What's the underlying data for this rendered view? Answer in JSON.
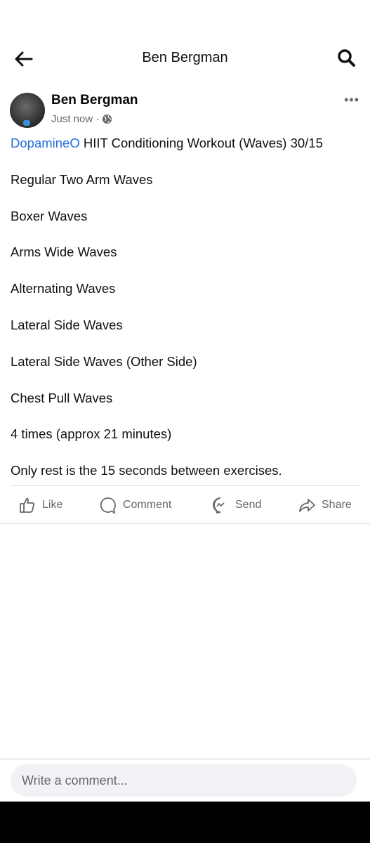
{
  "header": {
    "title": "Ben Bergman",
    "back_icon": "arrow-left-icon",
    "search_icon": "search-icon"
  },
  "post": {
    "author": "Ben Bergman",
    "timestamp": "Just now",
    "separator": "·",
    "privacy_icon": "globe-icon",
    "more_label": "•••",
    "tag": "DopamineO",
    "lines": [
      " HIIT Conditioning Workout (Waves) 30/15",
      "Regular Two Arm Waves",
      "Boxer Waves",
      "Arms Wide Waves",
      "Alternating Waves",
      "Lateral Side Waves",
      "Lateral Side Waves (Other Side)",
      "Chest Pull Waves",
      "4 times (approx 21 minutes)",
      "Only rest is the 15 seconds between exercises."
    ]
  },
  "actions": {
    "like": "Like",
    "comment": "Comment",
    "send": "Send",
    "share": "Share"
  },
  "comment_input": {
    "placeholder": "Write a comment...",
    "value": ""
  },
  "colors": {
    "link": "#216fdb",
    "secondary_text": "#65676b",
    "input_bg": "#f0f2f5"
  }
}
